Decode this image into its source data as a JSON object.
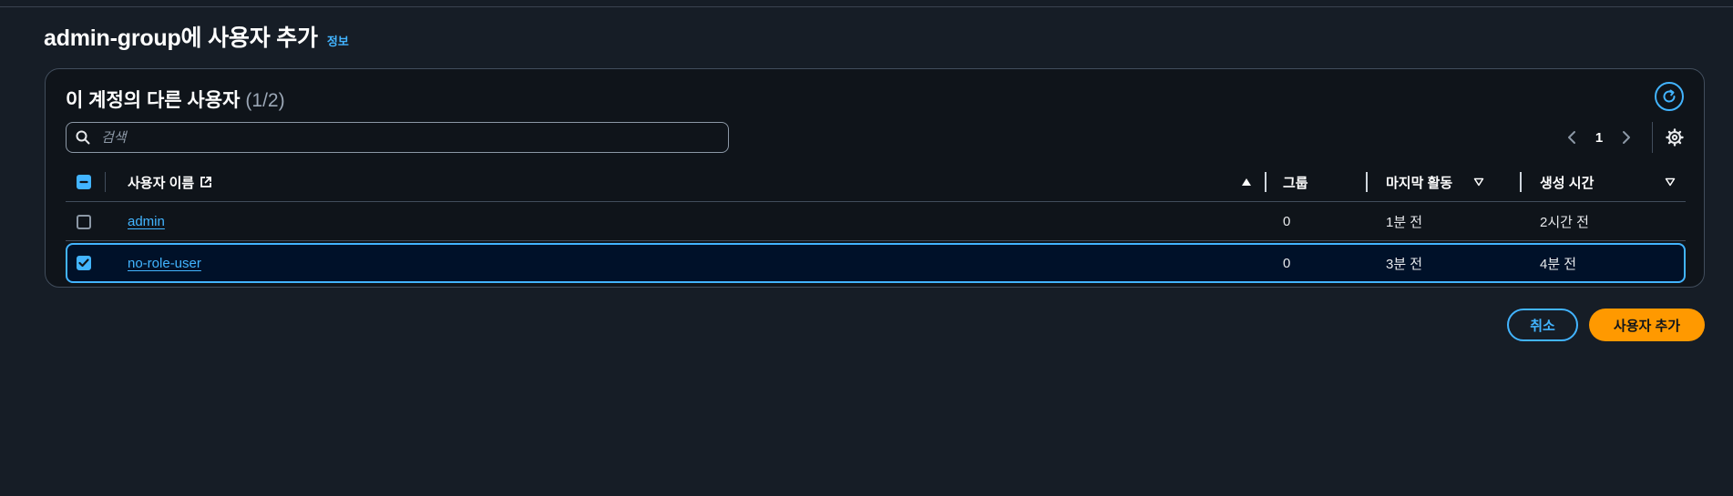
{
  "header": {
    "title": "admin-group에 사용자 추가",
    "info_link": "정보"
  },
  "container": {
    "title": "이 계정의 다른 사용자",
    "count": "(1/2)"
  },
  "search": {
    "placeholder": "검색",
    "value": ""
  },
  "pagination": {
    "current_page": "1"
  },
  "table": {
    "columns": {
      "username": "사용자 이름",
      "groups": "그룹",
      "last_activity": "마지막 활동",
      "created": "생성 시간"
    },
    "rows": [
      {
        "username": "admin",
        "groups": "0",
        "last_activity": "1분 전",
        "created": "2시간 전",
        "selected": false
      },
      {
        "username": "no-role-user",
        "groups": "0",
        "last_activity": "3분 전",
        "created": "4분 전",
        "selected": true
      }
    ]
  },
  "actions": {
    "cancel_label": "취소",
    "add_label": "사용자 추가"
  },
  "colors": {
    "background": "#161d26",
    "accent": "#42b4ff",
    "primary": "#ff9900",
    "selected_row": "#001129"
  },
  "icons": [
    "search-icon",
    "refresh-icon",
    "chevron-left-icon",
    "chevron-right-icon",
    "settings-gear-icon",
    "external-link-icon",
    "sort-ascending-icon",
    "sort-descending-icon"
  ]
}
